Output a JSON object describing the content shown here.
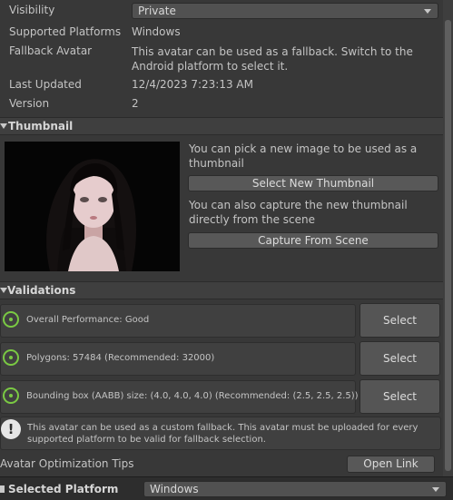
{
  "info": {
    "visibility_label": "Visibility",
    "visibility_value": "Private",
    "platforms_label": "Supported Platforms",
    "platforms_value": "Windows",
    "fallback_label": "Fallback Avatar",
    "fallback_value": "This avatar can be used as a fallback. Switch to the Android platform to select it.",
    "updated_label": "Last Updated",
    "updated_value": "12/4/2023 7:23:13 AM",
    "version_label": "Version",
    "version_value": "2"
  },
  "thumbnail": {
    "title": "Thumbnail",
    "pick_text": "You can pick a new image to be used as a thumbnail",
    "select_button": "Select New Thumbnail",
    "capture_text": "You can also capture the new thumbnail directly from the scene",
    "capture_button": "Capture From Scene"
  },
  "validations": {
    "title": "Validations",
    "items": [
      {
        "text": "Overall Performance: Good",
        "button": "Select"
      },
      {
        "text": "Polygons: 57484 (Recommended: 32000)",
        "button": "Select"
      },
      {
        "text": "Bounding box (AABB) size: (4.0, 4.0, 4.0) (Recommended: (2.5, 2.5, 2.5))",
        "button": "Select"
      }
    ],
    "warning_text": "This avatar can be used as a custom fallback. This avatar must be uploaded for every supported platform to be valid for fallback selection."
  },
  "tips": {
    "label": "Avatar Optimization Tips",
    "button": "Open Link"
  },
  "platform": {
    "label": "Selected Platform",
    "value": "Windows"
  },
  "colors": {
    "ok_green": "#7ac943",
    "background": "#383838"
  }
}
